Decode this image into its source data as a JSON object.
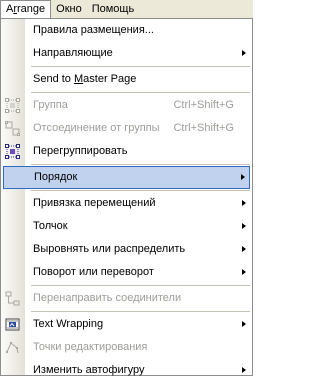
{
  "menubar": {
    "items": [
      {
        "label_pre": "A",
        "label_ul": "r",
        "label_post": "range",
        "active": true
      },
      {
        "label": "Окно"
      },
      {
        "label": "Помощь"
      }
    ]
  },
  "menu": {
    "items": [
      {
        "label": "Правила размещения..."
      },
      {
        "label": "Направляющие",
        "submenu": true
      },
      {
        "sep": true
      },
      {
        "label_pre": "Send to ",
        "label_ul": "M",
        "label_post": "aster Page"
      },
      {
        "sep": true
      },
      {
        "label": "Группа",
        "shortcut": "Ctrl+Shift+G",
        "disabled": true,
        "icon": "group-icon"
      },
      {
        "label": "Отсоединение от группы",
        "shortcut": "Ctrl+Shift+G",
        "disabled": true,
        "icon": "ungroup-icon"
      },
      {
        "label": "Перегруппировать",
        "icon": "regroup-icon"
      },
      {
        "sep": true
      },
      {
        "label": "Порядок",
        "submenu": true,
        "highlighted": true
      },
      {
        "sep": true
      },
      {
        "label": "Привязка перемещений",
        "submenu": true
      },
      {
        "label": "Толчок",
        "submenu": true
      },
      {
        "label": "Выровнять или распределить",
        "submenu": true
      },
      {
        "label": "Поворот или переворот",
        "submenu": true
      },
      {
        "sep": true
      },
      {
        "label": "Перенаправить соединители",
        "disabled": true,
        "icon": "reroute-connectors-icon"
      },
      {
        "sep": true
      },
      {
        "label": "Text Wrapping",
        "submenu": true,
        "icon": "text-wrapping-icon"
      },
      {
        "label": "Точки редактирования",
        "disabled": true,
        "icon": "edit-points-icon"
      },
      {
        "label": "Изменить автофигуру",
        "submenu": true
      }
    ]
  }
}
